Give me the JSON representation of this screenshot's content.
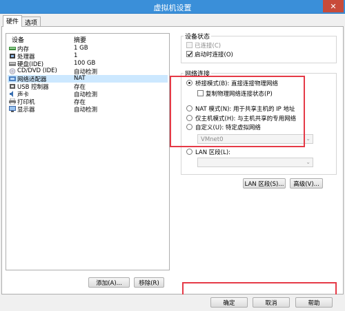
{
  "window": {
    "title": "虚拟机设置",
    "close_glyph": "✕"
  },
  "tabs": [
    {
      "label": "硬件"
    },
    {
      "label": "选项"
    }
  ],
  "device_list": {
    "columns": [
      "设备",
      "摘要"
    ],
    "rows": [
      {
        "name": "内存",
        "summary": "1 GB",
        "icon": "memory-icon"
      },
      {
        "name": "处理器",
        "summary": "1",
        "icon": "processor-icon"
      },
      {
        "name": "硬盘(IDE)",
        "summary": "100 GB",
        "icon": "hard-disk-icon"
      },
      {
        "name": "CD/DVD (IDE)",
        "summary": "自动检测",
        "icon": "cd-dvd-icon"
      },
      {
        "name": "网络适配器",
        "summary": "NAT",
        "icon": "network-adapter-icon",
        "selected": true
      },
      {
        "name": "USB 控制器",
        "summary": "存在",
        "icon": "usb-icon"
      },
      {
        "name": "声卡",
        "summary": "自动检测",
        "icon": "sound-card-icon"
      },
      {
        "name": "打印机",
        "summary": "存在",
        "icon": "printer-icon"
      },
      {
        "name": "显示器",
        "summary": "自动检测",
        "icon": "display-icon"
      }
    ],
    "add_label": "添加(A)...",
    "remove_label": "移除(R)"
  },
  "device_status": {
    "title": "设备状态",
    "connected": "已连接(C)",
    "connect_on_power": "启动时连接(O)"
  },
  "network": {
    "title": "网络连接",
    "bridged": "桥接模式(B): 直接连接物理网络",
    "replicate": "复制物理网络连接状态(P)",
    "nat": "NAT 模式(N): 用于共享主机的 IP 地址",
    "hostonly": "仅主机模式(H): 与主机共享的专用网络",
    "custom": "自定义(U): 特定虚拟网络",
    "vmnet_value": "VMnet0",
    "lan": "LAN 区段(L):",
    "lan_segments_btn": "LAN 区段(S)...",
    "advanced_btn": "高级(V)..."
  },
  "footer": {
    "ok": "确定",
    "cancel": "取消",
    "help": "帮助"
  },
  "colors": {
    "highlight": "#e53946",
    "selection": "#cce8ff",
    "titlebar": "#3a8fd9"
  }
}
